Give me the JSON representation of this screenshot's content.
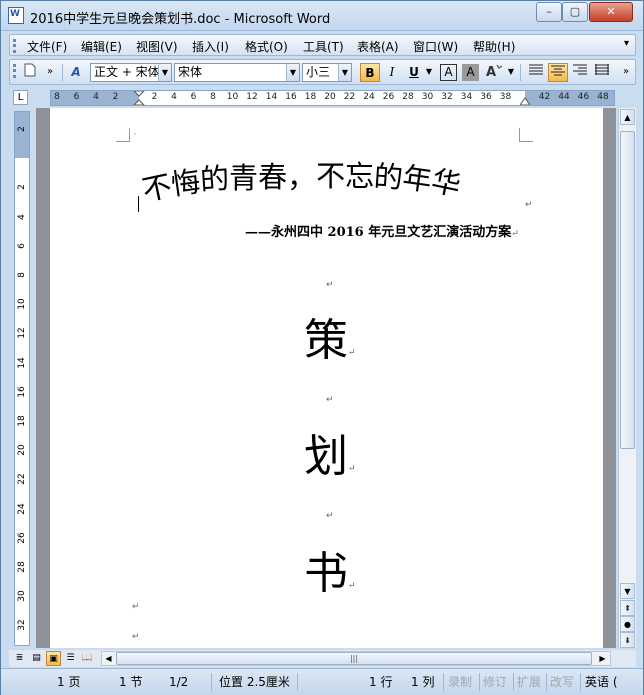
{
  "window": {
    "title": "2016中学生元旦晚会策划书.doc - Microsoft Word",
    "app_icon_letter": "W",
    "controls": {
      "minimize": "–",
      "maximize": "▢",
      "close": "✕"
    }
  },
  "menu": {
    "items": [
      "文件(F)",
      "编辑(E)",
      "视图(V)",
      "插入(I)",
      "格式(O)",
      "工具(T)",
      "表格(A)",
      "窗口(W)",
      "帮助(H)"
    ],
    "overflow": "▾"
  },
  "toolbar": {
    "new_doc_icon": "page-icon",
    "style_icon_text": "A",
    "style_value": "正文 + 宋体",
    "font_value": "宋体",
    "size_value": "小三",
    "bold_label": "B",
    "italic_label": "I",
    "underline_label": "U",
    "char_border_label": "A",
    "char_shading_label": "A",
    "align_center_active": true,
    "overflow": "»"
  },
  "ruler": {
    "corner": "L",
    "h_ticks": [
      "8",
      "6",
      "4",
      "2",
      "",
      "2",
      "4",
      "6",
      "8",
      "10",
      "12",
      "14",
      "16",
      "18",
      "20",
      "22",
      "24",
      "26",
      "28",
      "30",
      "32",
      "34",
      "36",
      "38",
      "",
      "42",
      "44",
      "46",
      "48"
    ],
    "v_ticks": [
      "2",
      "",
      "2",
      "4",
      "6",
      "8",
      "10",
      "12",
      "14",
      "16",
      "18",
      "20",
      "22",
      "24",
      "26",
      "28",
      "30",
      "32",
      "34"
    ]
  },
  "document": {
    "title_chars": [
      "不",
      "悔",
      "的",
      "青",
      "春",
      "，",
      "不",
      "忘",
      "的",
      "年",
      "华"
    ],
    "subtitle": "——永州四中 2016 年元旦文艺汇演活动方案",
    "big_chars": [
      "策",
      "划",
      "书"
    ],
    "para_mark": "↵"
  },
  "scroll": {
    "up": "▲",
    "down": "▼",
    "prev_page": "⇞",
    "select_object": "●",
    "next_page": "⇟",
    "h_left": "◀",
    "h_right": "▶",
    "h_grip": "|||"
  },
  "view_buttons": [
    "≣",
    "▤",
    "▣",
    "☰",
    "📖"
  ],
  "status": {
    "page": "1 页",
    "section": "1 节",
    "page_of": "1/2",
    "position": "位置 2.5厘米",
    "line": "1 行",
    "column": "1 列",
    "rec": "录制",
    "trk": "修订",
    "ext": "扩展",
    "ovr": "改写",
    "language": "英语 ("
  }
}
